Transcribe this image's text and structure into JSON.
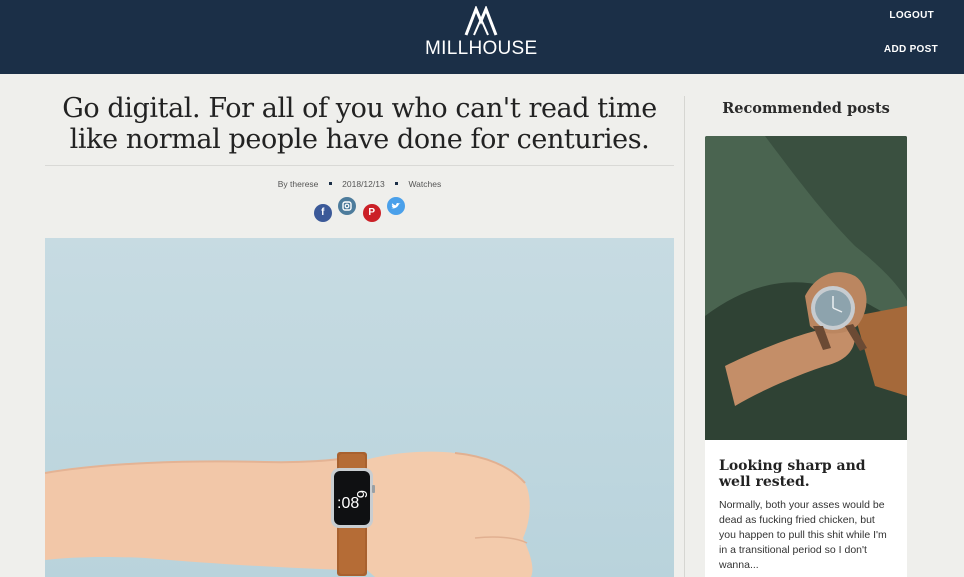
{
  "header": {
    "brand": "MILLHOUSE",
    "logout_label": "LOGOUT",
    "add_post_label": "ADD POST",
    "background_color": "#1b2f47"
  },
  "post": {
    "title": "Go digital. For all of you who can't read time like normal people have done for centuries.",
    "author": "By therese",
    "date": "2018/12/13",
    "category": "Watches",
    "share_icons": [
      "facebook-icon",
      "instagram-icon",
      "pinterest-icon",
      "twitter-icon"
    ],
    "hero_image": {
      "watch_digit_top": "6",
      "watch_digits_bottom": ":08"
    }
  },
  "sidebar": {
    "heading": "Recommended posts",
    "card": {
      "title": "Looking sharp and well rested.",
      "excerpt": "Normally, both your asses would be dead as fucking fried chicken, but you happen to pull this shit while I'm in a transitional period so I don't wanna..."
    }
  }
}
